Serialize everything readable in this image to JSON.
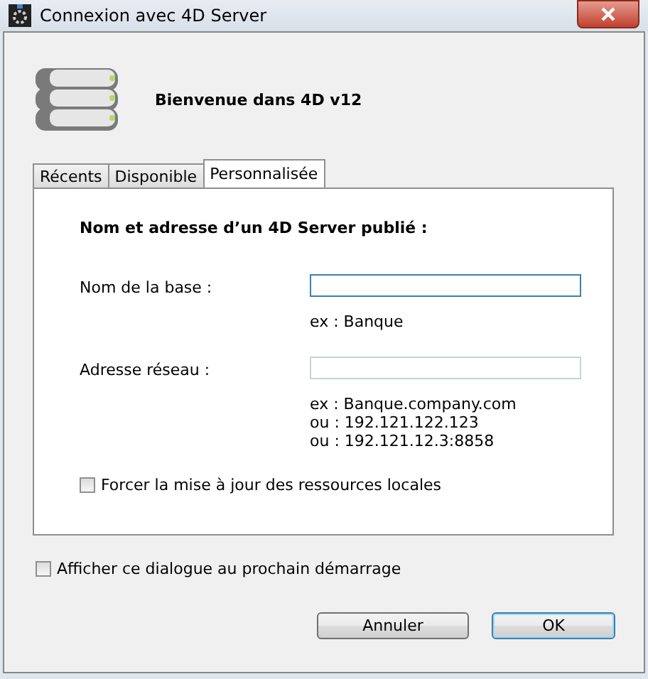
{
  "window": {
    "title": "Connexion avec 4D Server"
  },
  "welcome": "Bienvenue dans 4D v12",
  "tabs": [
    {
      "label": "Récents",
      "selected": false
    },
    {
      "label": "Disponible",
      "selected": false
    },
    {
      "label": "Personnalisée",
      "selected": true
    }
  ],
  "panel": {
    "heading": "Nom et adresse d’un 4D Server publié :",
    "fields": [
      {
        "label": "Nom de la base :",
        "focused": true,
        "hints": [
          "ex : Banque"
        ]
      },
      {
        "label": "Adresse réseau :",
        "focused": false,
        "hints": [
          "ex : Banque.company.com",
          "ou : 192.121.122.123",
          "ou : 192.121.12.3:8858"
        ]
      }
    ],
    "force_update": {
      "label": "Forcer la mise à jour des ressources locales",
      "checked": false
    }
  },
  "show_at_startup": {
    "label": "Afficher ce dialogue au prochain démarrage",
    "checked": false
  },
  "buttons": [
    {
      "label": "Annuler",
      "default": false
    },
    {
      "label": "OK",
      "default": true
    }
  ]
}
